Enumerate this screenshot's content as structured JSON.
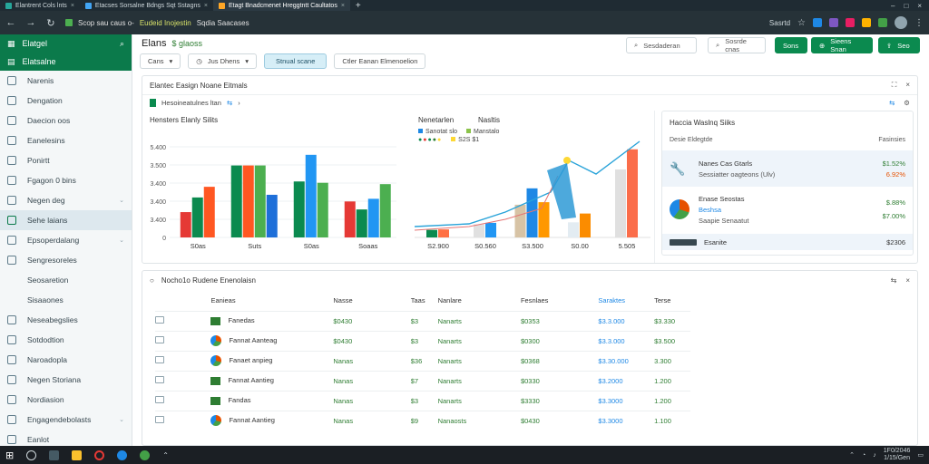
{
  "browser": {
    "tabs": [
      {
        "label": "Elantrent Cols lnts",
        "color": "#26a69a"
      },
      {
        "label": "Etacses Sorsalne Bdngs Sqt Sstagns",
        "color": "#42a5f5"
      },
      {
        "label": "Etagt Bnadcmenet Hreggtntt Caultatos",
        "color": "#ffa726"
      }
    ],
    "url_prefix": "Scop sau caus o-",
    "url_highlight": "Eudeid Inojestin",
    "url_suffix": "Sqdia Saacases",
    "ext_label": "Sasrtd"
  },
  "sidebar": {
    "title": "Elatgel",
    "subtitle": "Elatsalne",
    "items": [
      {
        "label": "Narenis",
        "chev": false,
        "indent": false,
        "active": false
      },
      {
        "label": "Dengation",
        "chev": false,
        "indent": false,
        "active": false
      },
      {
        "label": "Daecion oos",
        "chev": false,
        "indent": false,
        "active": false
      },
      {
        "label": "Eanelesins",
        "chev": false,
        "indent": false,
        "active": false
      },
      {
        "label": "Ponirtt",
        "chev": false,
        "indent": false,
        "active": false
      },
      {
        "label": "Fgagon 0 bins",
        "chev": false,
        "indent": false,
        "active": false
      },
      {
        "label": "Negen deg",
        "chev": true,
        "indent": false,
        "active": false
      },
      {
        "label": "Sehe laians",
        "chev": false,
        "indent": false,
        "active": true
      },
      {
        "label": "Epsoperdalang",
        "chev": true,
        "indent": false,
        "active": false
      },
      {
        "label": "Sengresoreles",
        "chev": false,
        "indent": false,
        "active": false
      },
      {
        "label": "Seosaretion",
        "chev": false,
        "indent": true,
        "active": false
      },
      {
        "label": "Sisaaones",
        "chev": false,
        "indent": true,
        "active": false
      },
      {
        "label": "Neseabegslies",
        "chev": false,
        "indent": false,
        "active": false
      },
      {
        "label": "Sotdodtion",
        "chev": false,
        "indent": false,
        "active": false
      },
      {
        "label": "Naroadopla",
        "chev": false,
        "indent": false,
        "active": false
      },
      {
        "label": "Negen Storiana",
        "chev": false,
        "indent": false,
        "active": false
      },
      {
        "label": "Nordiasion",
        "chev": false,
        "indent": false,
        "active": false
      },
      {
        "label": "Engagendebolasts",
        "chev": true,
        "indent": false,
        "active": false
      },
      {
        "label": "Eanlot",
        "chev": false,
        "indent": false,
        "active": false
      }
    ]
  },
  "header": {
    "title": "Elans",
    "title_tag": "$ glaoss",
    "filters": [
      "Cans",
      "Jus Dhens",
      "Stnual scane",
      "Ctler Eanan Elmenoelion"
    ],
    "actions": [
      "Sesdaderan",
      "Sosrde cnas",
      "Sons",
      "Sieens Snan",
      "Seo"
    ]
  },
  "panel1": {
    "title": "Elantec Easign Noane Eitmals",
    "subtitle": "Hesoineatulnes ltan",
    "chart1_title": "Hensters Elanly Silits",
    "chart2_title": "Nenetarlen",
    "chart2_title2": "Nasltis",
    "legend": [
      {
        "label": "Sanotat slo",
        "color": "#1e88e5"
      },
      {
        "label": "Manstalo",
        "color": "#8bc34a"
      },
      {
        "label": "Saanta",
        "color": "#1565c0"
      },
      {
        "label": "S2S $1",
        "color": "#fdd835"
      }
    ]
  },
  "chart_data": [
    {
      "type": "bar",
      "title": "Hensters Elanly Silits",
      "categories": [
        "S0as",
        "Suts",
        "S0as",
        "Soaas"
      ],
      "yticks": [
        "5.400",
        "3.500",
        "3.400",
        "3.400",
        "3.400",
        "0"
      ],
      "series": [
        {
          "color": "#e53935",
          "values": [
            950,
            0,
            0,
            1350
          ]
        },
        {
          "color": "#0b8a4f",
          "values": [
            1500,
            2700,
            2100,
            1050
          ]
        },
        {
          "color": "#ff5722",
          "values": [
            1900,
            2700,
            0,
            0
          ]
        },
        {
          "color": "#2196f3",
          "values": [
            0,
            0,
            3100,
            1450
          ]
        },
        {
          "color": "#4caf50",
          "values": [
            0,
            2700,
            2050,
            2000
          ]
        },
        {
          "color": "#1e6fd9",
          "values": [
            0,
            1600,
            0,
            0
          ]
        }
      ],
      "ylim": [
        0,
        3400
      ]
    },
    {
      "type": "bar",
      "title": "Nenetarlen",
      "categories": [
        "S2.900",
        "S0.560",
        "S3.500",
        "S0.00",
        "5.505"
      ],
      "series": [
        {
          "color": "#0b8a4f",
          "values": [
            300,
            0,
            0,
            0,
            0
          ]
        },
        {
          "color": "#ff7043",
          "values": [
            320,
            0,
            0,
            0,
            0
          ]
        },
        {
          "color": "#2e7d32",
          "values": [
            0,
            0,
            0,
            0,
            0
          ]
        },
        {
          "color": "#e0e0e0",
          "values": [
            0,
            520,
            0,
            0,
            0
          ]
        },
        {
          "color": "#2196f3",
          "values": [
            0,
            580,
            0,
            0,
            0
          ]
        },
        {
          "color": "#d7c3a5",
          "values": [
            0,
            0,
            1300,
            0,
            0
          ]
        },
        {
          "color": "#1e88e5",
          "values": [
            0,
            0,
            1950,
            0,
            0
          ]
        },
        {
          "color": "#ff9800",
          "values": [
            0,
            0,
            1400,
            0,
            0
          ]
        },
        {
          "color": "#e3ecf2",
          "values": [
            0,
            0,
            0,
            600,
            0
          ]
        },
        {
          "color": "#fb8c00",
          "values": [
            0,
            0,
            0,
            950,
            0
          ]
        },
        {
          "color": "#e0e0e0",
          "values": [
            0,
            0,
            0,
            0,
            2700
          ]
        },
        {
          "color": "#fb6d4a",
          "values": [
            0,
            0,
            0,
            0,
            3500
          ]
        }
      ],
      "ylim": [
        0,
        3600
      ]
    }
  ],
  "summary": {
    "title": "Haccia Waslnq Siiks",
    "col1": "Desie Eldegtde",
    "col2": "Fasinsies",
    "rows": [
      {
        "label": "Nanes Cas Gtarls",
        "sub": "Sessiatter oagteons (Ulv)",
        "v1": "$1.52%",
        "v2": "6.92%",
        "active": true
      },
      {
        "label": "Enase Seostas",
        "sub": "Beshsa",
        "sub2": "Saapie Senaatut",
        "v1": "$.88%",
        "v2": "$7.00%",
        "active": false
      },
      {
        "label": "Esanite",
        "sub": "",
        "v1": "$2306",
        "v2": "",
        "active": true
      }
    ]
  },
  "table": {
    "title": "Nocho1o Rudene Enenolaisn",
    "headers": [
      "Eanieas",
      "Nasse",
      "Taas",
      "Nanlare",
      "Fesnlaes",
      "Saraktes",
      "Terse"
    ],
    "rows": [
      {
        "icon": "sheet",
        "name": "Fanedas",
        "c2": "$0430",
        "c3": "$3",
        "c4": "Nanarts",
        "c5": "$0353",
        "c6": "$3.3.000",
        "c7": "$3.330"
      },
      {
        "icon": "pie",
        "name": "Fannat Aanteag",
        "c2": "$0430",
        "c3": "$3",
        "c4": "Nanarts",
        "c5": "$0300",
        "c6": "$3.3.000",
        "c7": "$3.500"
      },
      {
        "icon": "pie",
        "name": "Fanaet anpieg",
        "c2": "Nanas",
        "c3": "$36",
        "c4": "Nanarts",
        "c5": "$0368",
        "c6": "$3.30.000",
        "c7": "3.300"
      },
      {
        "icon": "sheet",
        "name": "Fannat Aantieg",
        "c2": "Nanas",
        "c3": "$7",
        "c4": "Nanarts",
        "c5": "$0330",
        "c6": "$3.2000",
        "c7": "1.200"
      },
      {
        "icon": "sheet",
        "name": "Fandas",
        "c2": "Nanas",
        "c3": "$3",
        "c4": "Nanarts",
        "c5": "$3330",
        "c6": "$3.3000",
        "c7": "1.200"
      },
      {
        "icon": "pie",
        "name": "Fannat Aantieg",
        "c2": "Nanas",
        "c3": "$9",
        "c4": "Nanaosts",
        "c5": "$0430",
        "c6": "$3.3000",
        "c7": "1.100"
      }
    ]
  },
  "taskbar": {
    "time": "1/15/Gen",
    "tray": "1F0/2046"
  }
}
